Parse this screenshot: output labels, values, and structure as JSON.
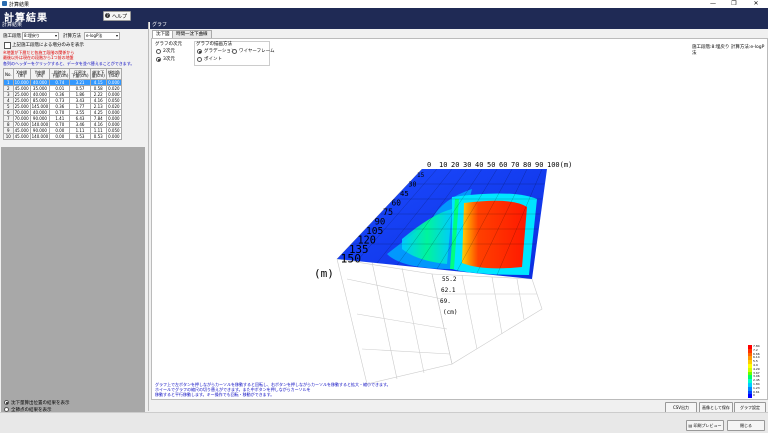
{
  "window": {
    "title": "計算結果",
    "controls": [
      "—",
      "❐",
      "✕"
    ]
  },
  "header": {
    "title": "計算結果",
    "help_label": "ヘルプ"
  },
  "left": {
    "section_title": "計算結果",
    "stage_label": "施工段階",
    "stage_value": "8:埋戻り",
    "method_label": "計算方法",
    "method_value": "e-logP法",
    "checkbox_label": "上記施工段階による増分のみを表示",
    "notes": [
      "※地盤が下層だと各施工段階の関係から",
      "最後以外は現在の段階から1つ前の地盤",
      "各列のヘッダーをクリックすると、データを並べ替えることができます。"
    ],
    "table": {
      "headers": [
        "No.",
        "X座標\n(m)",
        "Y座標\n(m)",
        "即時沈\n下量(cm)",
        "圧密沈\n下量(cm)",
        "総沈下\n量(cm)",
        "傾斜角\n(rad)"
      ],
      "rows": [
        [
          "1",
          "10.000",
          "40.000",
          "0.74",
          "3.21",
          "4.15",
          "0.000"
        ],
        [
          "2",
          "45.000",
          "35.000",
          "0.01",
          "0.57",
          "0.58",
          "0.020"
        ],
        [
          "3",
          "25.000",
          "40.000",
          "0.36",
          "1.86",
          "2.22",
          "0.000"
        ],
        [
          "4",
          "25.000",
          "85.000",
          "0.73",
          "3.43",
          "4.16",
          "0.050"
        ],
        [
          "5",
          "25.000",
          "145.000",
          "0.36",
          "1.77",
          "2.13",
          "0.020"
        ],
        [
          "6",
          "70.000",
          "40.000",
          "0.70",
          "3.55",
          "4.25",
          "0.000"
        ],
        [
          "7",
          "70.000",
          "90.000",
          "1.41",
          "6.43",
          "7.84",
          "0.000"
        ],
        [
          "8",
          "70.000",
          "140.000",
          "0.70",
          "3.46",
          "4.16",
          "0.000"
        ],
        [
          "9",
          "45.000",
          "90.000",
          "0.00",
          "1.11",
          "1.11",
          "0.050"
        ],
        [
          "10",
          "45.000",
          "140.000",
          "0.00",
          "0.53",
          "0.53",
          "0.000"
        ]
      ]
    },
    "radio1_label": "沈下量算出位置の結果を表示",
    "radio2_label": "全節点の結果を表示"
  },
  "right": {
    "panel_title": "グラフ",
    "tabs": [
      "沈下図",
      "時間一沈下曲線"
    ],
    "dim_group_label": "グラフの次元",
    "dim_options": [
      "2次元",
      "3次元"
    ],
    "draw_group_label": "グラフの描画方法",
    "draw_options": [
      "グラデーション",
      "ワイヤーフレーム",
      "ポイント"
    ],
    "info_text": "施工段階:8:埋戻り 計算方法:e-logP法",
    "x_axis_ticks": [
      "0",
      "10",
      "20",
      "30",
      "40",
      "50",
      "60",
      "70",
      "80",
      "90",
      "100(m)"
    ],
    "y_axis_ticks": [
      "15",
      "30",
      "45",
      "60",
      "75",
      "90",
      "105",
      "120",
      "135",
      "150"
    ],
    "y_unit": "(m)",
    "z_axis_ticks": [
      "55.2",
      "62.1",
      "69."
    ],
    "z_unit": "(cm)",
    "legend_values": [
      "7.84",
      "7.2",
      "6.66",
      "6.14",
      "5.5",
      "4.9",
      "4.29",
      "3.67",
      "3.06",
      "2.45",
      "1.84",
      "1.23",
      "0.61",
      "0"
    ],
    "legend_colors": [
      "#ff0000",
      "#ff3300",
      "#ff6600",
      "#ff9900",
      "#ffcc00",
      "#ffff00",
      "#ccff00",
      "#66ff00",
      "#00ff66",
      "#00ffcc",
      "#00ccff",
      "#0088ff",
      "#0044ff",
      "#0000ff"
    ],
    "help_lines": [
      "グラフ上で左ボタンを押しながらカーソルを移動すると回転し、右ボタンを押しながらカーソルを移動すると拡大・縮小できます。",
      "ホイールでグラフの縮尺の切り替えができます。また中ボタンを押しながらカーソルを",
      "移動すると平行移動します。キー操作でも回転・移動ができます。"
    ],
    "buttons": [
      "CSV出力",
      "画像として保存",
      "グラフ設定"
    ]
  },
  "statusbar": {
    "print_preview": "印刷プレビュー",
    "close": "閉じる"
  }
}
